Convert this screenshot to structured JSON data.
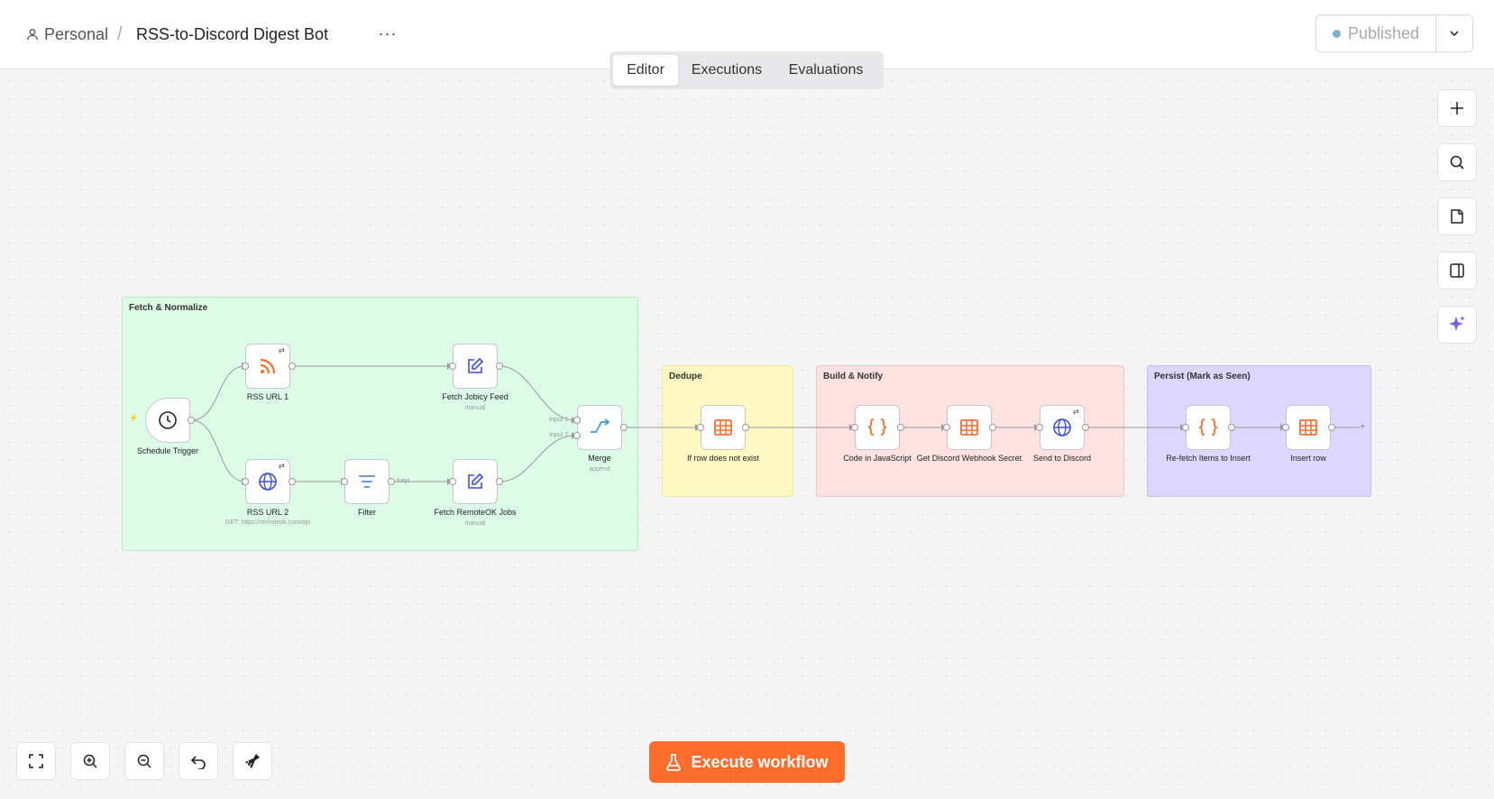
{
  "header": {
    "project": "Personal",
    "separator": "/",
    "workflow_title": "RSS-to-Discord Digest Bot",
    "more_label": "···",
    "publish_status": "Published"
  },
  "tabs": [
    {
      "label": "Editor",
      "active": true
    },
    {
      "label": "Executions",
      "active": false
    },
    {
      "label": "Evaluations",
      "active": false
    }
  ],
  "right_toolbar": [
    "plus-icon",
    "search-icon",
    "sticky-note-icon",
    "panel-icon",
    "sparkle-icon"
  ],
  "groups": {
    "fetch": {
      "title": "Fetch & Normalize",
      "color": "#dcfce7"
    },
    "dedupe": {
      "title": "Dedupe",
      "color": "#fef9c3"
    },
    "notify": {
      "title": "Build & Notify",
      "color": "#fee2e2"
    },
    "persist": {
      "title": "Persist (Mark as Seen)",
      "color": "#ddd6fe"
    }
  },
  "nodes": {
    "schedule": {
      "label": "Schedule Trigger",
      "icon": "clock-icon"
    },
    "rss1": {
      "label": "RSS URL 1",
      "icon": "rss-icon"
    },
    "rss2": {
      "label": "RSS URL 2",
      "sub": "GET: https://remoteok.com/api",
      "icon": "globe-icon"
    },
    "filter": {
      "label": "Filter",
      "icon": "filter-icon"
    },
    "jobicy": {
      "label": "Fetch Jobicy Feed",
      "sub": "manual",
      "icon": "edit-icon"
    },
    "remoteok": {
      "label": "Fetch RemoteOK Jobs",
      "sub": "manual",
      "icon": "edit-icon"
    },
    "merge": {
      "label": "Merge",
      "sub": "append",
      "icon": "merge-icon"
    },
    "dedupe": {
      "label": "If row does not exist",
      "icon": "table-icon"
    },
    "code": {
      "label": "Code in JavaScript",
      "icon": "braces-icon"
    },
    "webhook": {
      "label": "Get Discord Webhook Secret",
      "icon": "table-icon"
    },
    "discord": {
      "label": "Send to Discord",
      "icon": "globe-icon"
    },
    "refetch": {
      "label": "Re-fetch Items to Insert",
      "icon": "braces-icon"
    },
    "insert": {
      "label": "Insert row",
      "icon": "table-icon"
    }
  },
  "edge_labels": {
    "kept": "Kept",
    "input1": "Input 1",
    "input2": "Input 2"
  },
  "bottom_toolbar": [
    "fit-view-icon",
    "zoom-in-icon",
    "zoom-out-icon",
    "undo-icon",
    "broom-icon"
  ],
  "execute_label": "Execute workflow",
  "colors": {
    "accent": "#ff6d2d",
    "orange_icon": "#ff6d2d",
    "blue_icon": "#3b4fd8"
  }
}
